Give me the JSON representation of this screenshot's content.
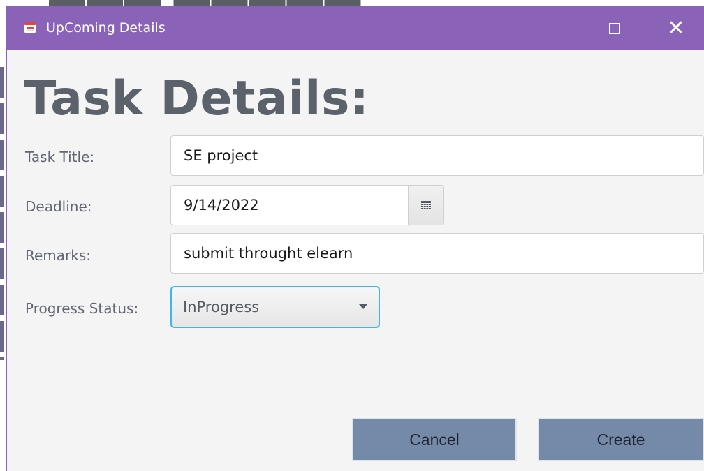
{
  "window": {
    "title": "UpComing Details",
    "title_bar_color": "#8a63b8",
    "controls": {
      "minimize_icon": "minimize-icon",
      "maximize_icon": "maximize-icon",
      "close_icon": "close-icon",
      "close_glyph": "✕"
    }
  },
  "form": {
    "heading": "Task Details:",
    "task_title": {
      "label": "Task Title:",
      "value": "SE project"
    },
    "deadline": {
      "label": "Deadline:",
      "value": "9/14/2022",
      "picker_icon": "calendar-icon"
    },
    "remarks": {
      "label": "Remarks:",
      "value": "submit throught elearn"
    },
    "progress_status": {
      "label": "Progress Status:",
      "value": "InProgress",
      "focus_color": "#3eb6e8"
    }
  },
  "actions": {
    "cancel_label": "Cancel",
    "create_label": "Create",
    "button_color": "#7589a8"
  }
}
